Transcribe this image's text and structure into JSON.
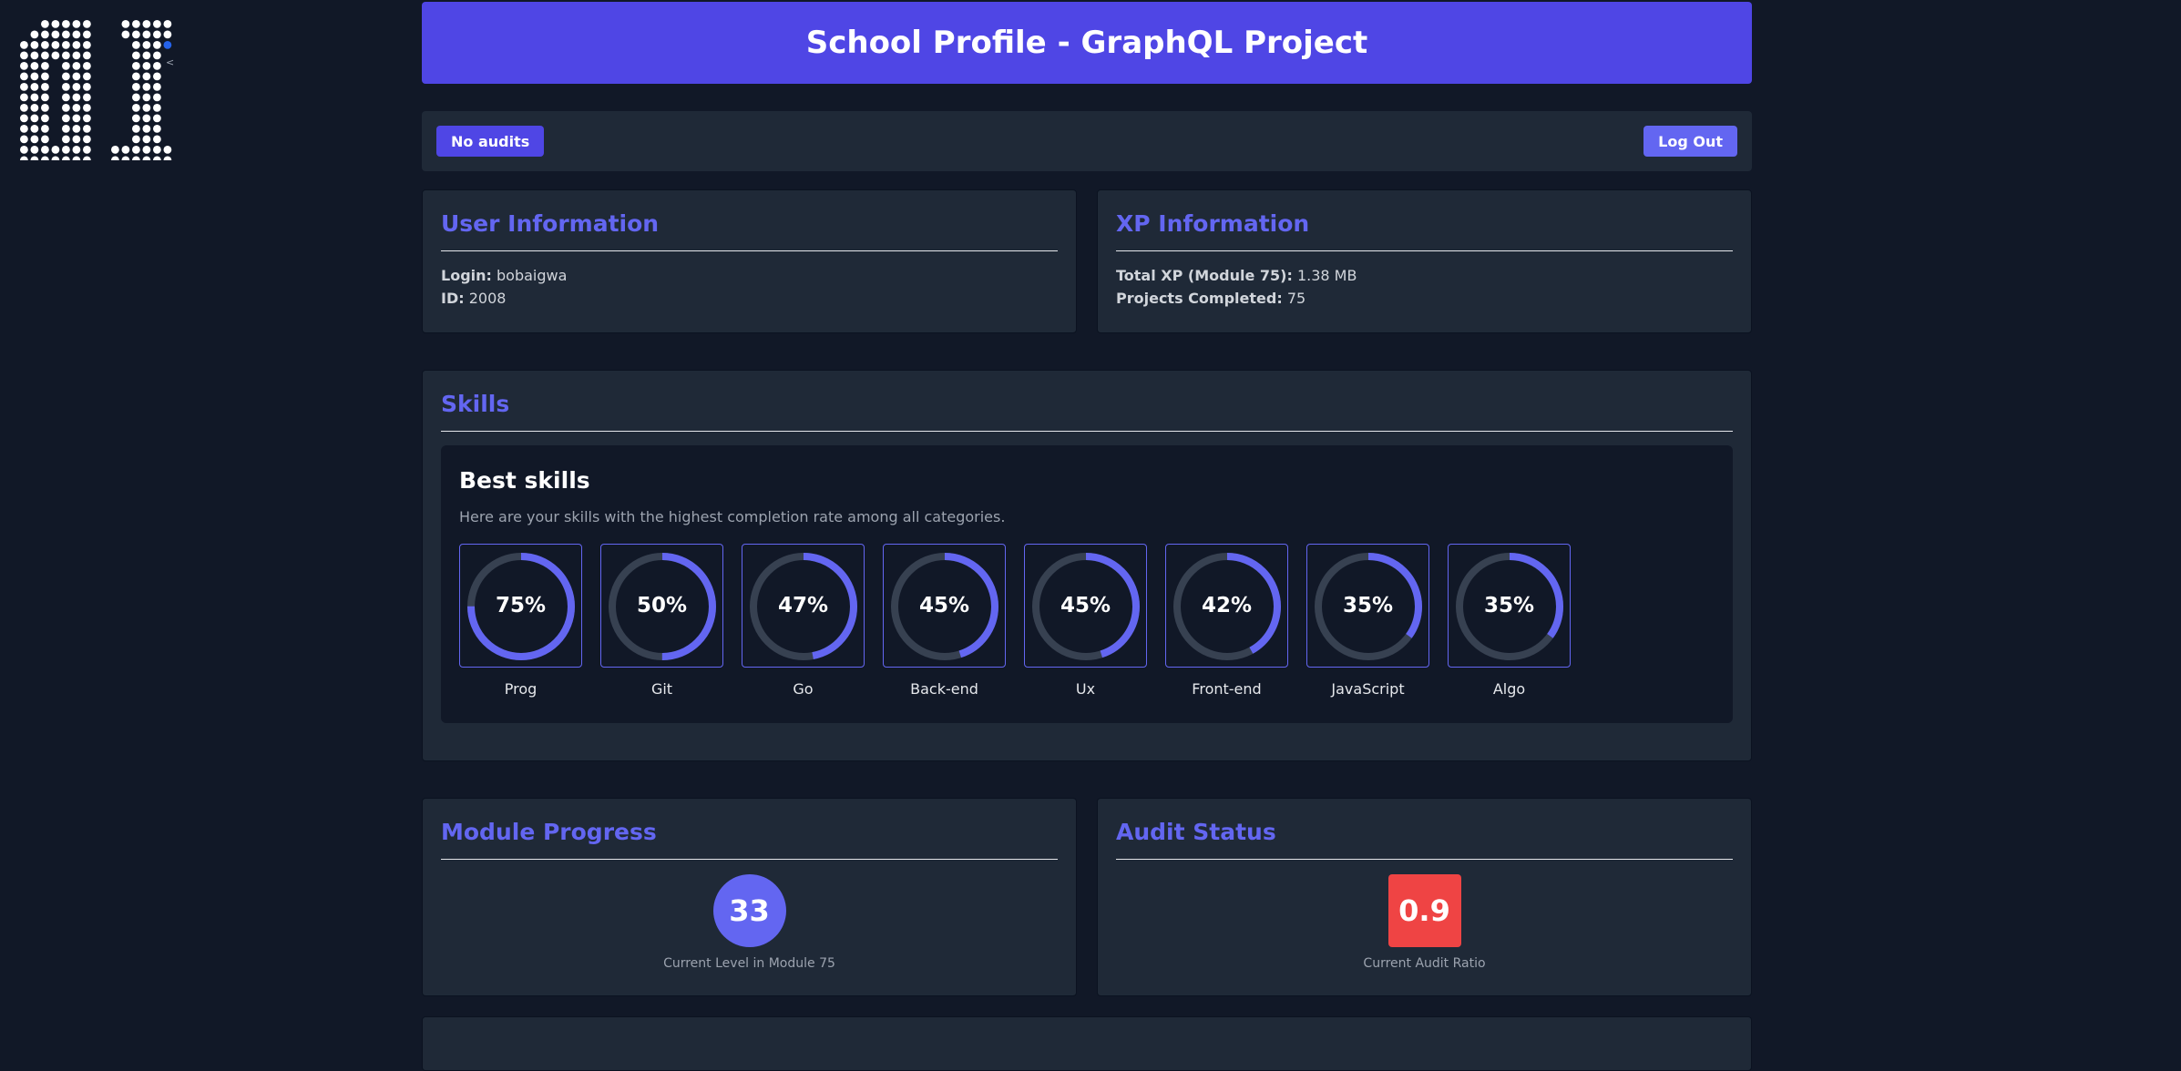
{
  "header": {
    "title": "School Profile - GraphQL Project"
  },
  "toolbar": {
    "audits_label": "No audits",
    "logout_label": "Log Out"
  },
  "user_info": {
    "title": "User Information",
    "login_label": "Login:",
    "login_value": "bobaigwa",
    "id_label": "ID:",
    "id_value": "2008"
  },
  "xp_info": {
    "title": "XP Information",
    "total_label": "Total XP (Module 75):",
    "total_value": "1.38 MB",
    "projects_label": "Projects Completed:",
    "projects_value": "75"
  },
  "skills": {
    "title": "Skills",
    "best_title": "Best skills",
    "best_desc": "Here are your skills with the highest completion rate among all categories.",
    "items": [
      {
        "name": "Prog",
        "label": "75%",
        "pct": 75
      },
      {
        "name": "Git",
        "label": "50%",
        "pct": 50
      },
      {
        "name": "Go",
        "label": "47%",
        "pct": 47
      },
      {
        "name": "Back-end",
        "label": "45%",
        "pct": 45
      },
      {
        "name": "Ux",
        "label": "45%",
        "pct": 45
      },
      {
        "name": "Front-end",
        "label": "42%",
        "pct": 42
      },
      {
        "name": "JavaScript",
        "label": "35%",
        "pct": 35
      },
      {
        "name": "Algo",
        "label": "35%",
        "pct": 35
      }
    ]
  },
  "module_progress": {
    "title": "Module Progress",
    "level": "33",
    "caption": "Current Level in Module 75"
  },
  "audit_status": {
    "title": "Audit Status",
    "ratio": "0.9",
    "caption": "Current Audit Ratio"
  },
  "colors": {
    "accent": "#6366f1",
    "header": "#4f46e5",
    "card": "#1f2937",
    "background": "#111827",
    "ring_track": "#374151",
    "audit_bad": "#ef4444"
  },
  "icons": {
    "logo": "school-01-logo"
  }
}
